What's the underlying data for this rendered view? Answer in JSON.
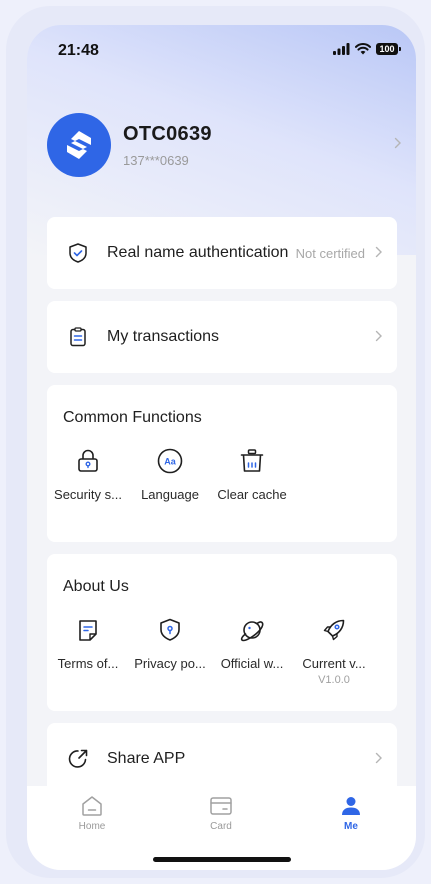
{
  "status_bar": {
    "time": "21:48",
    "battery": "100"
  },
  "profile": {
    "username": "OTC0639",
    "phone": "137***0639"
  },
  "rows": {
    "auth": {
      "label": "Real name authentication",
      "value": "Not certified"
    },
    "transactions": {
      "label": "My transactions"
    },
    "share": {
      "label": "Share APP"
    }
  },
  "common_functions": {
    "title": "Common Functions",
    "items": [
      {
        "label": "Security s...",
        "icon": "lock-icon"
      },
      {
        "label": "Language",
        "icon": "language-icon"
      },
      {
        "label": "Clear cache",
        "icon": "trash-icon"
      }
    ]
  },
  "about_us": {
    "title": "About Us",
    "items": [
      {
        "label": "Terms of...",
        "icon": "document-icon"
      },
      {
        "label": "Privacy po...",
        "icon": "shield-lock-icon"
      },
      {
        "label": "Official w...",
        "icon": "planet-icon"
      },
      {
        "label": "Current v...",
        "sub": "V1.0.0",
        "icon": "rocket-icon"
      }
    ]
  },
  "tabbar": {
    "tabs": [
      {
        "label": "Home",
        "icon": "home-icon"
      },
      {
        "label": "Card",
        "icon": "card-icon"
      },
      {
        "label": "Me",
        "icon": "person-icon",
        "active": true
      }
    ]
  },
  "colors": {
    "accent": "#2f66e6",
    "muted": "#9a9a9a"
  }
}
